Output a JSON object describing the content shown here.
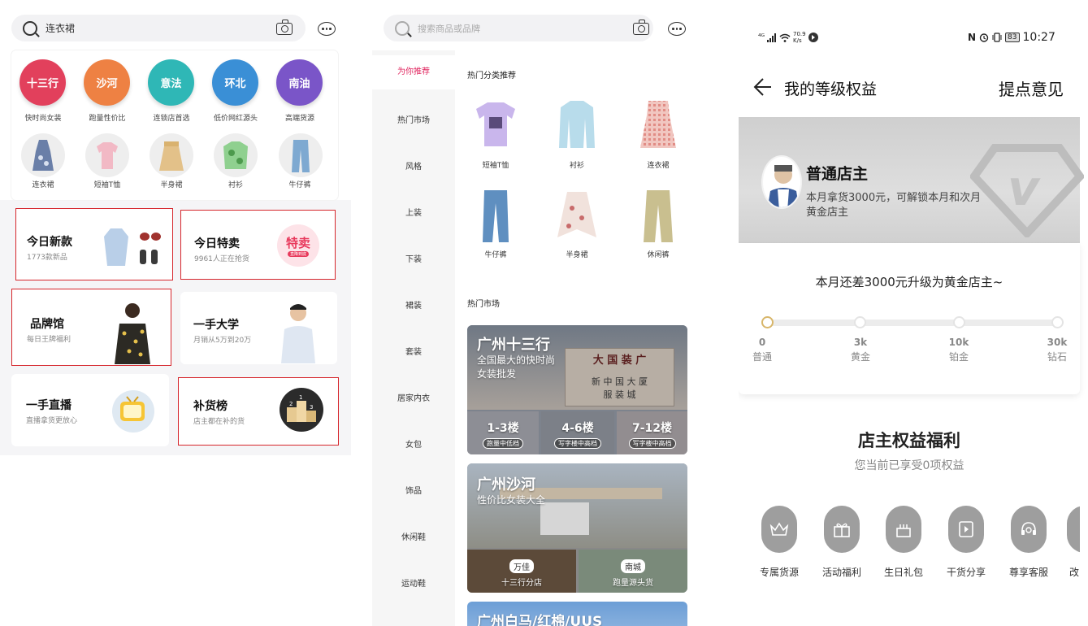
{
  "panel1": {
    "search": {
      "text": "连衣裙"
    },
    "top_categories": [
      {
        "name": "十三行",
        "caption": "快时尚女装",
        "color": "#e2405c"
      },
      {
        "name": "沙河",
        "caption": "跑量性价比",
        "color": "#ee8143"
      },
      {
        "name": "意法",
        "caption": "连锁店首选",
        "color": "#2fb7b6"
      },
      {
        "name": "环北",
        "caption": "低价网红源头",
        "color": "#3a8fd6"
      },
      {
        "name": "南油",
        "caption": "高端货源",
        "color": "#7a55c8"
      }
    ],
    "sub_categories": [
      "连衣裙",
      "短袖T恤",
      "半身裙",
      "衬衫",
      "牛仔裤"
    ],
    "cards": [
      {
        "title": "今日新款",
        "sub": "1773款新品"
      },
      {
        "title": "今日特卖",
        "sub": "9961人正在抢货",
        "badge": "特卖",
        "badge_sub": "直降到底"
      },
      {
        "title": "品牌馆",
        "sub": "每日王牌福利"
      },
      {
        "title": "一手大学",
        "sub": "月销从5万到20万"
      },
      {
        "title": "一手直播",
        "sub": "直播拿货更放心"
      },
      {
        "title": "补货榜",
        "sub": "店主都在补的货"
      }
    ]
  },
  "panel2": {
    "search": {
      "placeholder": "搜索商品或品牌"
    },
    "sidebar": [
      "为你推荐",
      "热门市场",
      "风格",
      "上装",
      "下装",
      "裙装",
      "套装",
      "居家内衣",
      "女包",
      "饰品",
      "休闲鞋",
      "运动鞋"
    ],
    "section1_title": "热门分类推荐",
    "products": [
      "短袖T恤",
      "衬衫",
      "连衣裙",
      "牛仔裤",
      "半身裙",
      "休闲裤"
    ],
    "section2_title": "热门市场",
    "markets": [
      {
        "title": "广州十三行",
        "sub1": "全国最大的快时尚",
        "sub2": "女装批发",
        "sign1": "大 国 装 广",
        "sign2": "新 中 国 大 厦",
        "sign3": "服 装 城",
        "floors": [
          {
            "name": "1-3楼",
            "label": "跑量中低档"
          },
          {
            "name": "4-6楼",
            "label": "写字楼中高档"
          },
          {
            "name": "7-12楼",
            "label": "写字楼中高档"
          }
        ]
      },
      {
        "title": "广州沙河",
        "sub1": "性价比女装大全",
        "branches": [
          {
            "tag": "万佳",
            "label": "十三行分店"
          },
          {
            "tag": "南城",
            "label": "跑量源头货"
          }
        ]
      },
      {
        "title": "广州白马/红棉/UUS"
      }
    ]
  },
  "panel3": {
    "status": {
      "network": "⁴ᴳ",
      "speed_top": "70.9",
      "speed_bottom": "K/s",
      "battery": "83",
      "time": "10:27"
    },
    "header": {
      "title": "我的等级权益",
      "action": "提点意见"
    },
    "hero": {
      "name": "普通店主",
      "desc1": "本月拿货3000元，可解锁本月和次月",
      "desc2": "黄金店主"
    },
    "upgrade_text": "本月还差3000元升级为黄金店主~",
    "levels": [
      {
        "value": "0",
        "name": "普通"
      },
      {
        "value": "3k",
        "name": "黄金"
      },
      {
        "value": "10k",
        "name": "铂金"
      },
      {
        "value": "30k",
        "name": "钻石"
      }
    ],
    "benefits_title": "店主权益福利",
    "benefits_sub": "您当前已享受0项权益",
    "benefits": [
      {
        "label": "专属货源",
        "icon": "crown-icon"
      },
      {
        "label": "活动福利",
        "icon": "gift-icon"
      },
      {
        "label": "生日礼包",
        "icon": "cake-icon"
      },
      {
        "label": "干货分享",
        "icon": "video-icon"
      },
      {
        "label": "尊享客服",
        "icon": "headset-icon"
      },
      {
        "label": "改",
        "icon": "partial-icon"
      }
    ]
  }
}
